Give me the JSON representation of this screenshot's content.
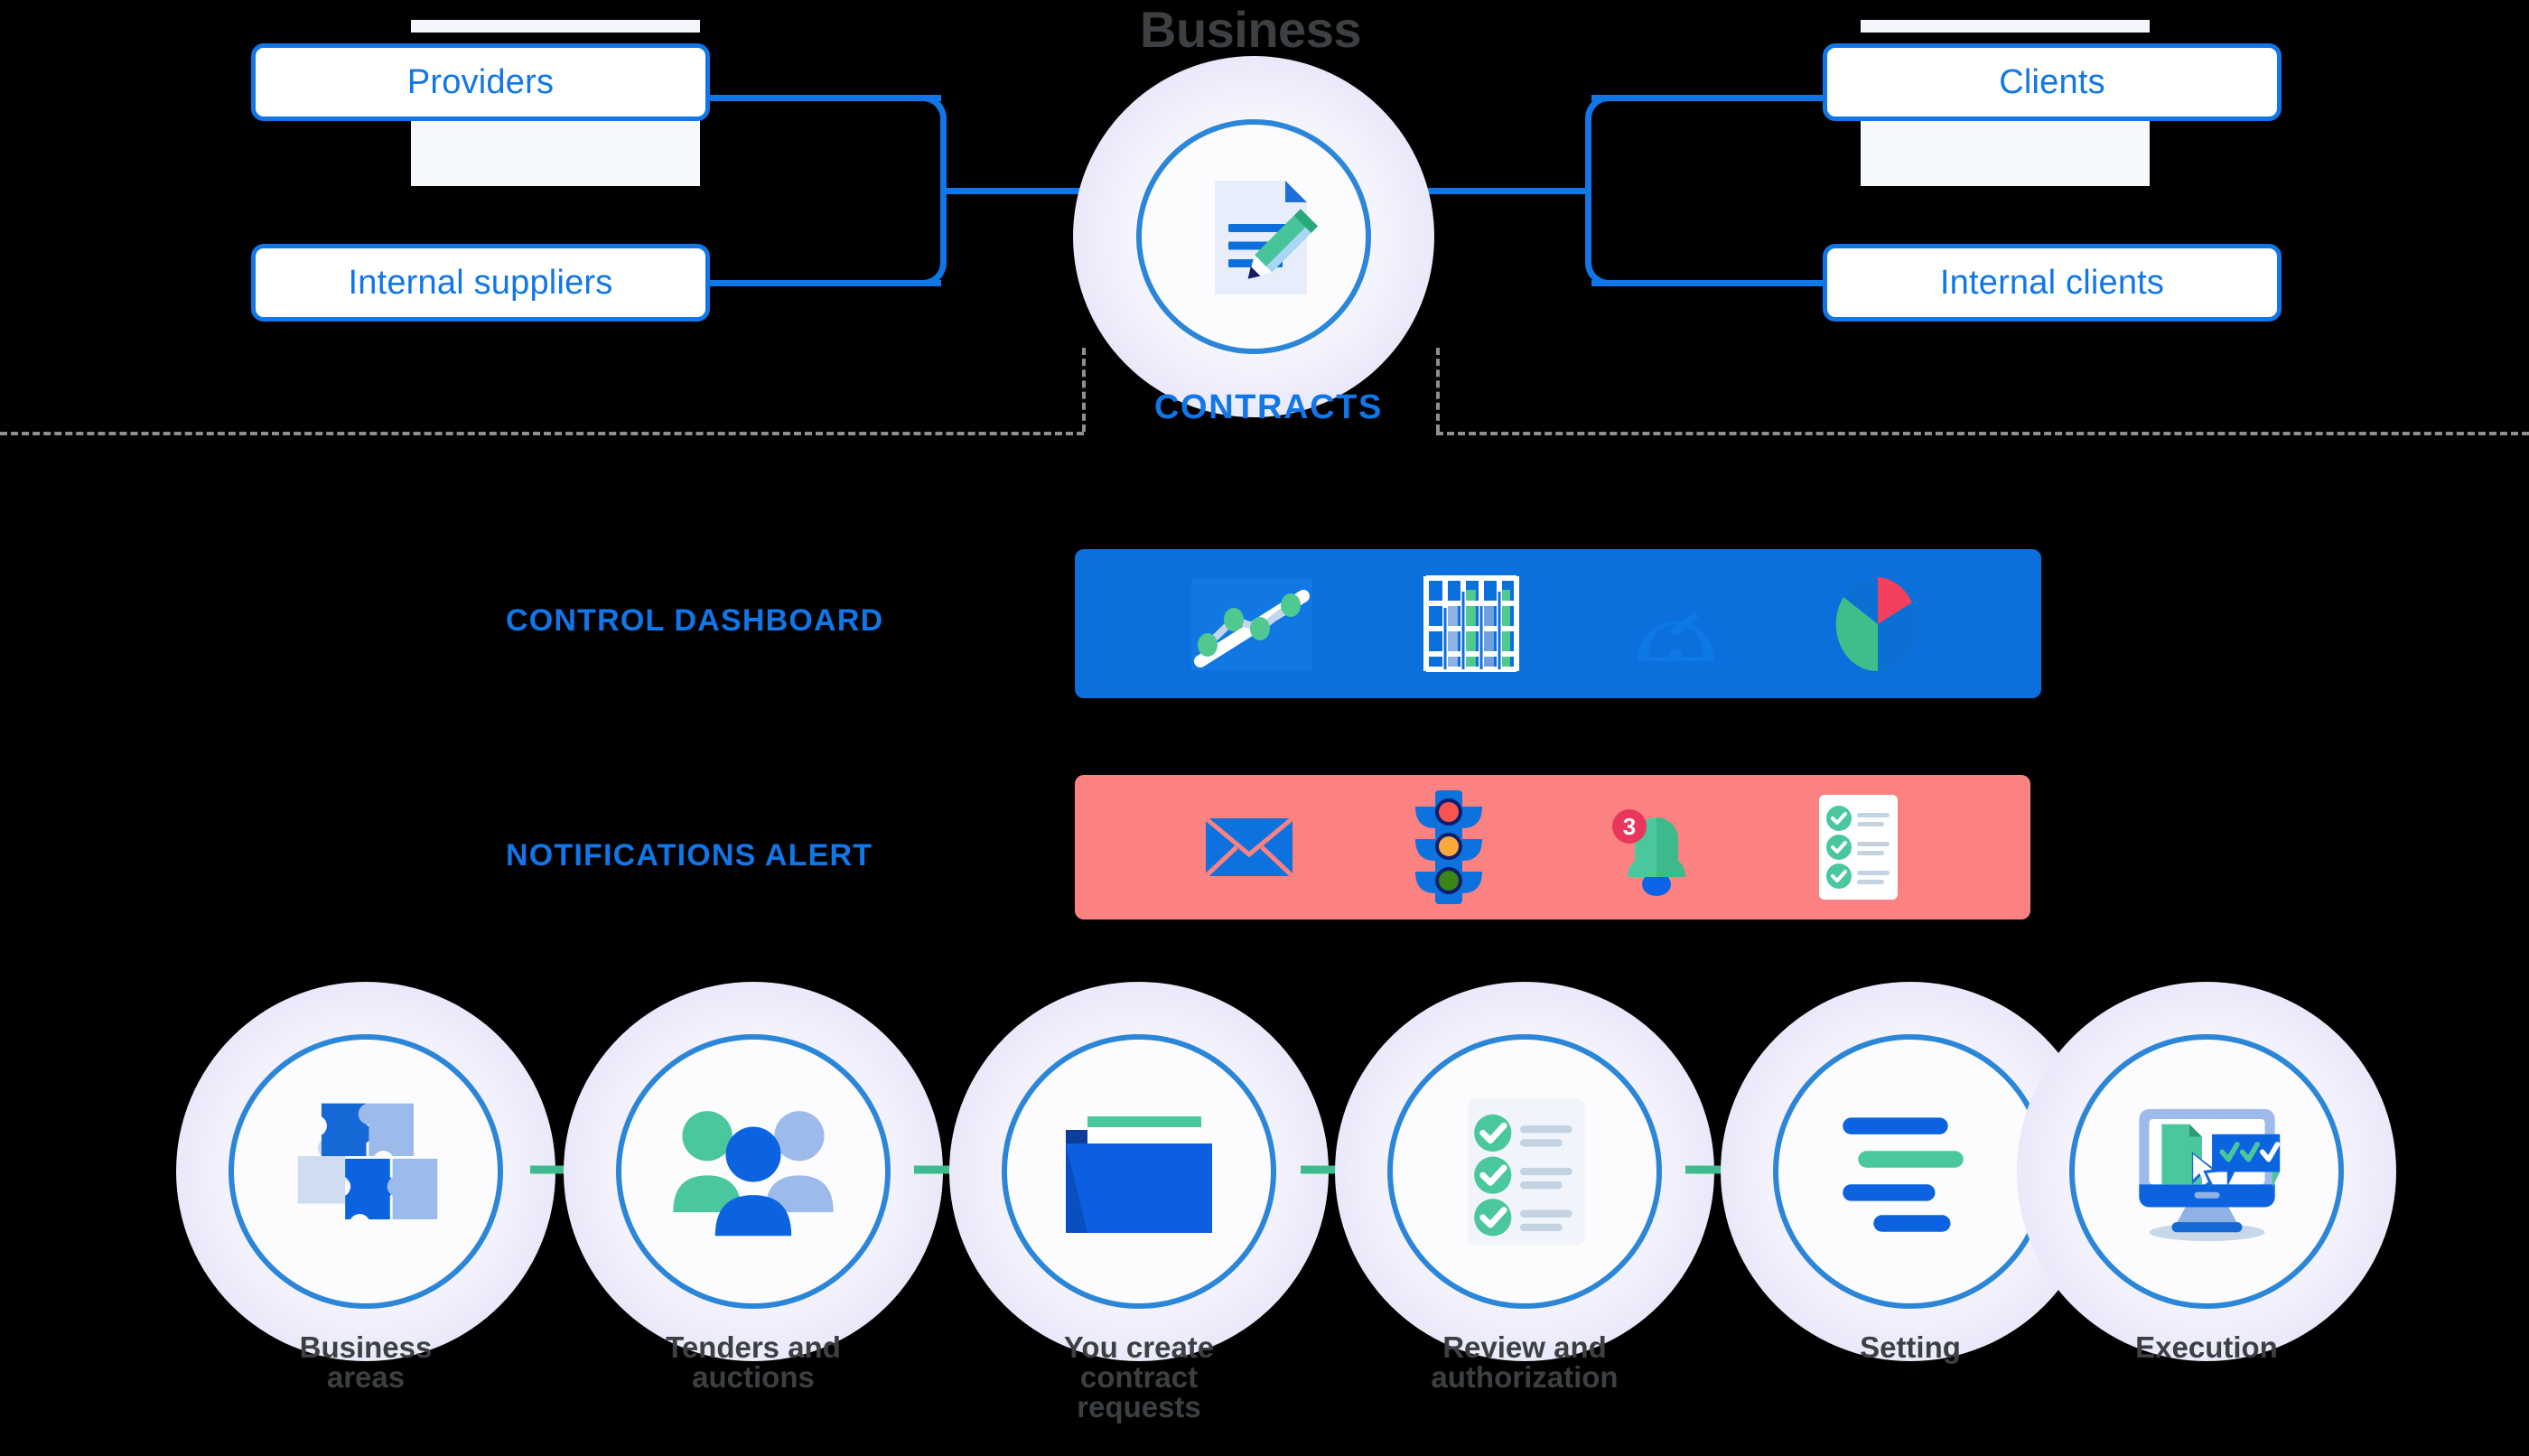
{
  "diagram": {
    "title": "Business",
    "center": {
      "label": "CONTRACTS",
      "icon": "document-pencil-icon"
    },
    "left_parties": [
      {
        "label": "Providers"
      },
      {
        "label": "Internal suppliers"
      }
    ],
    "right_parties": [
      {
        "label": "Clients"
      },
      {
        "label": "Internal clients"
      }
    ]
  },
  "bands": [
    {
      "id": "control-dashboard",
      "label": "CONTROL DASHBOARD",
      "color": "#0B70DC",
      "icons": [
        "line-chart-icon",
        "bar-chart-grid-icon",
        "gauge-icon",
        "pie-chart-icon"
      ]
    },
    {
      "id": "notifications-alert",
      "label": "NOTIFICATIONS ALERT",
      "color": "#FC8281",
      "icons": [
        "envelope-icon",
        "traffic-light-icon",
        "bell-icon",
        "checklist-icon"
      ],
      "bell_badge_count": "3"
    }
  ],
  "process": {
    "arrow_color": "#3DBB8C",
    "steps": [
      {
        "id": "business-areas",
        "label": "Business\nareas",
        "icon": "puzzle-icon"
      },
      {
        "id": "tenders-and-auctions",
        "label": "Tenders and\nauctions",
        "icon": "people-group-icon"
      },
      {
        "id": "contract-requests",
        "label": "You create\ncontract\nrequests",
        "icon": "folder-icon"
      },
      {
        "id": "review-and-authorization",
        "label": "Review and\nauthorization",
        "icon": "checklist-document-icon"
      },
      {
        "id": "setting",
        "label": "Setting",
        "icon": "settings-lines-icon"
      },
      {
        "id": "execution",
        "label": "Execution",
        "icon": "monitor-approve-icon"
      }
    ]
  },
  "colors": {
    "primary_blue": "#1176E8",
    "band_blue": "#0B70DC",
    "band_coral": "#FC8281",
    "green": "#3DBB8C",
    "ink": "#3C4043",
    "blob": "#EDECFB"
  }
}
